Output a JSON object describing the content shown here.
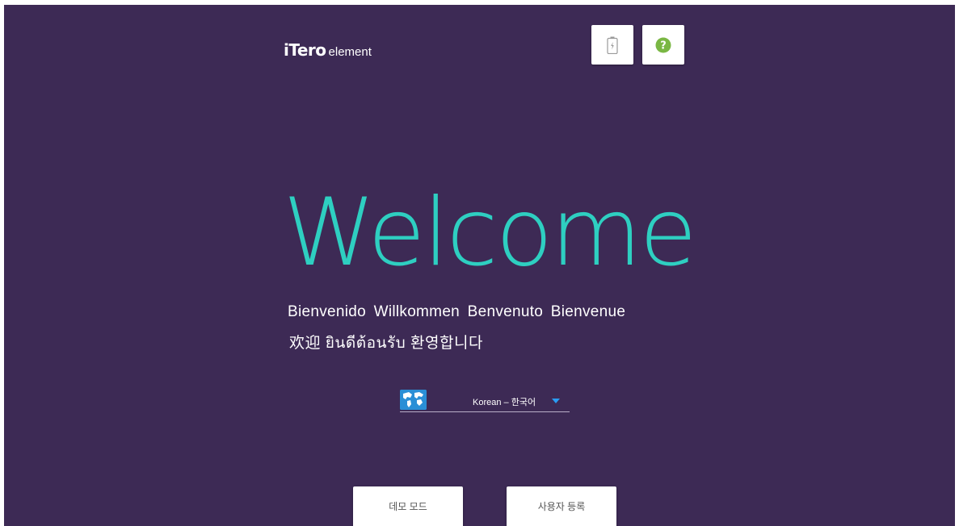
{
  "header": {
    "logo_brand": "iTero",
    "logo_sub": "element",
    "battery_button": {
      "icon": "battery-charging-icon"
    },
    "help_button": {
      "icon": "help-icon"
    }
  },
  "welcome": {
    "title": "Welcome",
    "languages_line1": "Bienvenido Willkommen Benvenuto Bienvenue",
    "languages_line2": "欢迎  ยินดีต้อนรับ  환영합니다"
  },
  "language_selector": {
    "icon": "globe-icon",
    "selected": "Korean – 한국어"
  },
  "actions": {
    "demo_mode": "데모 모드",
    "register_user": "사용자 등록"
  },
  "colors": {
    "background": "#3d2a55",
    "accent_teal": "#2ecfc1",
    "dropdown_caret": "#2a9cf2",
    "help_green": "#7ab744"
  }
}
